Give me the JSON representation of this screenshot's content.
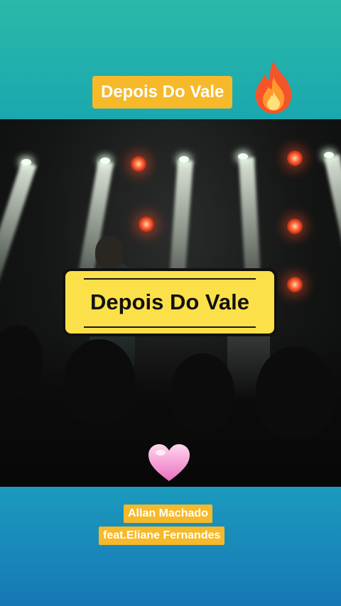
{
  "header": {
    "title": "Depois Do Vale",
    "emoji": "fire-icon"
  },
  "video": {
    "caption": "Depois Do Vale"
  },
  "decoration": {
    "emoji": "pink-heart-icon"
  },
  "credits": {
    "artist": "Allan Machado",
    "featuring": "feat.Eliane Fernandes"
  },
  "colors": {
    "top_band": "#2ab9a8",
    "bottom_band": "#1877b6",
    "pill": "#f6b92a",
    "caption_box": "#fbe04a"
  }
}
